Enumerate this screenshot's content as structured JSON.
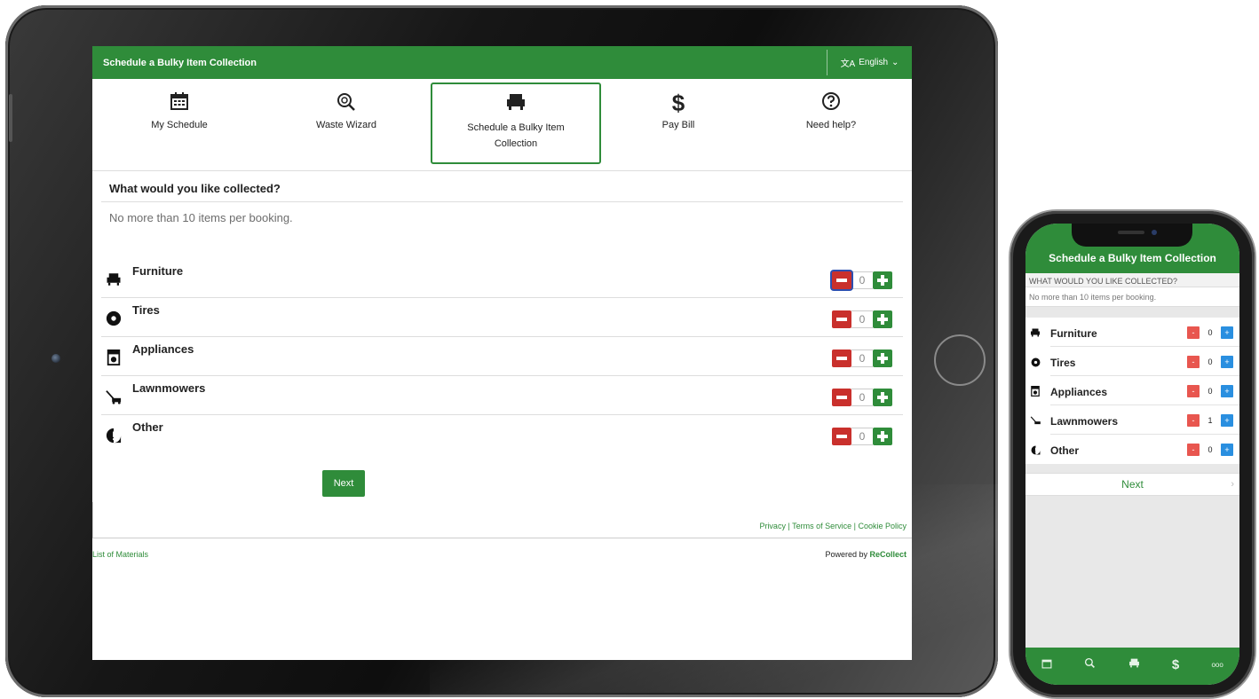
{
  "tablet": {
    "header_title": "Schedule a Bulky Item Collection",
    "language_label": "English",
    "nav": [
      {
        "label": "My Schedule",
        "icon": "calendar-icon"
      },
      {
        "label": "Waste Wizard",
        "icon": "magnifier-icon"
      },
      {
        "label": "Schedule a Bulky Item Collection",
        "icon": "armchair-icon",
        "active": true
      },
      {
        "label": "Pay Bill",
        "icon": "dollar-icon"
      },
      {
        "label": "Need help?",
        "icon": "question-icon"
      }
    ],
    "question": "What would you like collected?",
    "note": "No more than 10 items per booking.",
    "items": [
      {
        "label": "Furniture",
        "icon": "armchair-icon",
        "value": "0"
      },
      {
        "label": "Tires",
        "icon": "tire-icon",
        "value": "0"
      },
      {
        "label": "Appliances",
        "icon": "washer-icon",
        "value": "0"
      },
      {
        "label": "Lawnmowers",
        "icon": "lawnmower-icon",
        "value": "0"
      },
      {
        "label": "Other",
        "icon": "alert-icon",
        "value": "0"
      }
    ],
    "next_label": "Next",
    "footer_links": "Privacy | Terms of Service | Cookie Policy",
    "list_of_materials": "List of Materials",
    "powered_by": "Powered by",
    "brand": "ReCollect"
  },
  "phone": {
    "header_title": "Schedule a Bulky Item Collection",
    "section_title": "WHAT WOULD YOU LIKE COLLECTED?",
    "note": "No more than 10 items per booking.",
    "items": [
      {
        "label": "Furniture",
        "value": "0"
      },
      {
        "label": "Tires",
        "value": "0"
      },
      {
        "label": "Appliances",
        "value": "0"
      },
      {
        "label": "Lawnmowers",
        "value": "1"
      },
      {
        "label": "Other",
        "value": "0"
      }
    ],
    "next_label": "Next",
    "minus_symbol": "-",
    "plus_symbol": "+",
    "tab_dollar": "$",
    "tab_more": "ooo"
  },
  "colors": {
    "brand_green": "#2f8c3a",
    "minus_red": "#c9302c",
    "phone_plus_blue": "#2a8fe0"
  }
}
